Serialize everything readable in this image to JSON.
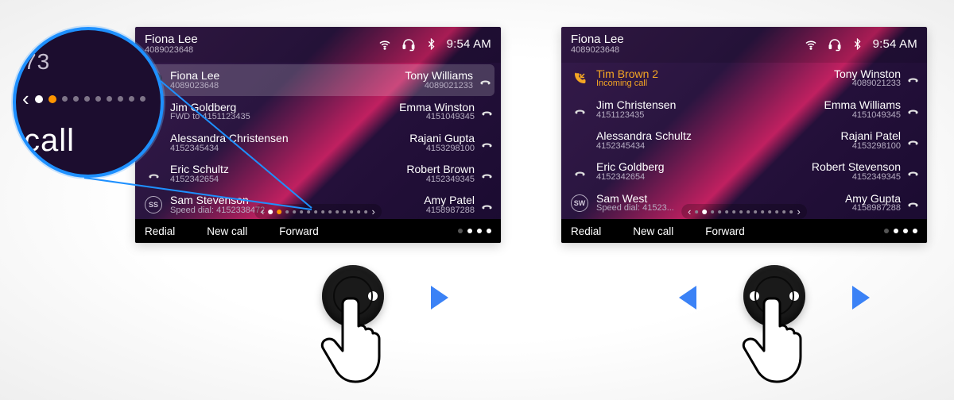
{
  "status": {
    "time": "9:54 AM"
  },
  "bottom": {
    "redial": "Redial",
    "newcall": "New call",
    "forward": "Forward"
  },
  "magnifier": {
    "top_fragment": "73",
    "bottom_fragment": "call"
  },
  "left": {
    "user": {
      "name": "Fiona Lee",
      "number": "4089023648"
    },
    "rows": [
      {
        "l_name": "Fiona Lee",
        "l_sub": "4089023648",
        "l_icon": "avatar-dark",
        "r_name": "Tony Williams",
        "r_sub": "4089021233"
      },
      {
        "l_name": "Jim Goldberg",
        "l_sub": "FWD to 4151123435",
        "l_icon": "none",
        "r_name": "Emma Winston",
        "r_sub": "4151049345"
      },
      {
        "l_name": "Alessandra Christensen",
        "l_sub": "4152345434",
        "l_icon": "none",
        "r_name": "Rajani Gupta",
        "r_sub": "4153298100"
      },
      {
        "l_name": "Eric Schultz",
        "l_sub": "4152342654",
        "l_icon": "phone-down",
        "r_name": "Robert Brown",
        "r_sub": "4152349345"
      },
      {
        "l_name": "Sam Stevenson",
        "l_sub": "Speed dial: 4152338472",
        "l_icon": "avatar-ss",
        "r_name": "Amy Patel",
        "r_sub": "4158987288"
      }
    ],
    "highlight_index": 0,
    "pager": {
      "current": 1,
      "active_extra": 2,
      "total": 14
    }
  },
  "right": {
    "user": {
      "name": "Fiona Lee",
      "number": "4089023648"
    },
    "rows": [
      {
        "l_name": "Tim Brown 2",
        "l_sub": "Incoming call",
        "l_icon": "incoming",
        "orange": true,
        "r_name": "Tony Winston",
        "r_sub": "4089021233"
      },
      {
        "l_name": "Jim Christensen",
        "l_sub": "4151123435",
        "l_icon": "phone-down",
        "r_name": "Emma Williams",
        "r_sub": "4151049345"
      },
      {
        "l_name": "Alessandra Schultz",
        "l_sub": "4152345434",
        "l_icon": "none",
        "r_name": "Rajani Patel",
        "r_sub": "4153298100"
      },
      {
        "l_name": "Eric Goldberg",
        "l_sub": "4152342654",
        "l_icon": "phone-down",
        "r_name": "Robert Stevenson",
        "r_sub": "4152349345"
      },
      {
        "l_name": "Sam West",
        "l_sub": "Speed dial: 41523...",
        "l_icon": "avatar-sw",
        "r_name": "Amy Gupta",
        "r_sub": "4158987288"
      }
    ],
    "highlight_index": -1,
    "pager": {
      "current": 2,
      "total": 14
    }
  }
}
